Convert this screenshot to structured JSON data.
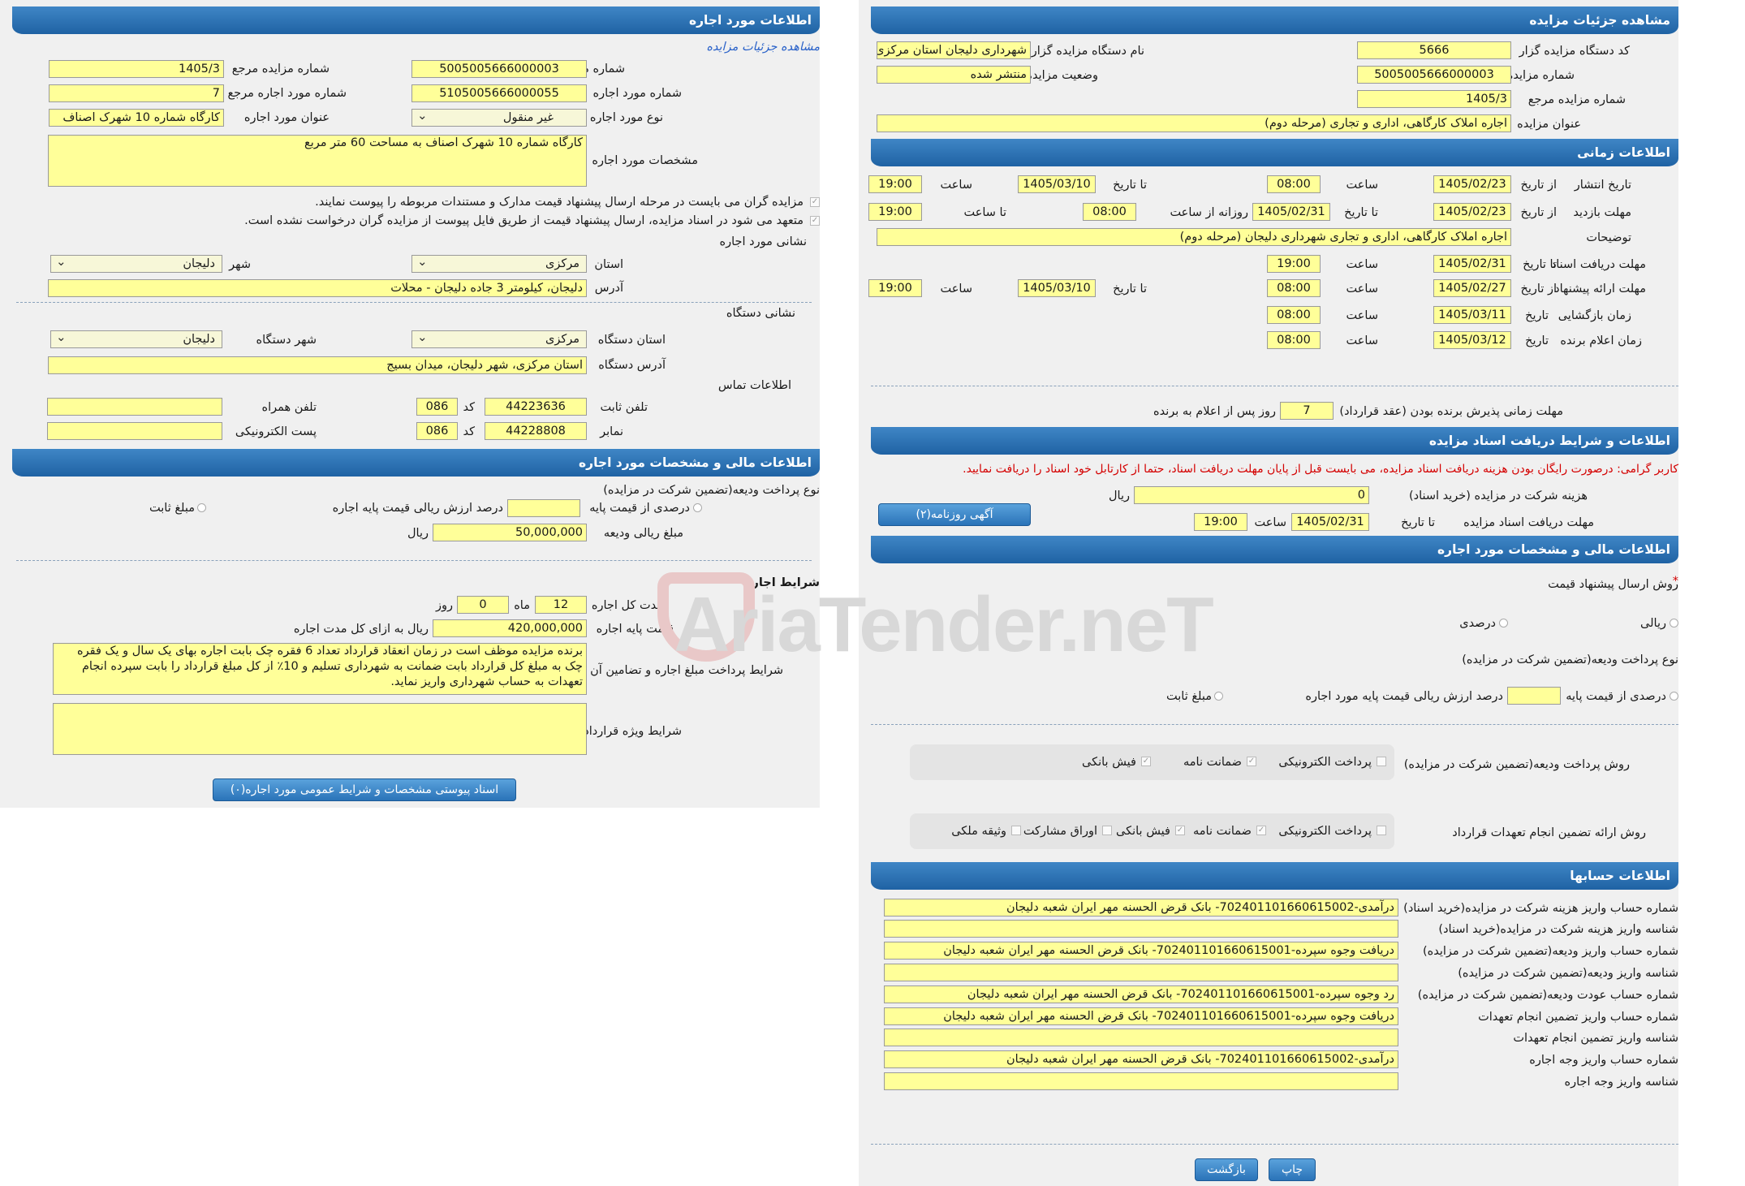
{
  "left": {
    "header": "اطلاعات مورد اجاره",
    "view_link": "مشاهده جزئیات مزایده",
    "fields": {
      "auction_no_label": "شماره مزایده",
      "auction_no": "5005005666000003",
      "ref_no_label": "شماره مزایده مرجع",
      "ref_no": "1405/3",
      "lease_item_no_label": "شماره مورد اجاره",
      "lease_item_no": "5105005666000055",
      "ref_lease_no_label": "شماره مورد اجاره مرجع",
      "ref_lease_no": "7",
      "lease_type_label": "نوع مورد اجاره",
      "lease_type": "غیر منقول",
      "lease_title_label": "عنوان مورد اجاره",
      "lease_title": "کارگاه شماره 10 شهرک اصناف",
      "specs_label": "مشخصات مورد اجاره",
      "specs": "کارگاه شماره 10 شهرک اصناف به مساحت 60 متر مربع"
    },
    "notes": [
      "مزایده گران می بایست در مرحله ارسال پیشنهاد قیمت مدارک و مستندات مربوطه را پیوست نمایند.",
      "متعهد می شود در اسناد مزایده، ارسال پیشنهاد قیمت از طریق فایل پیوست از مزایده گران درخواست نشده است."
    ],
    "address_title": "نشانی مورد اجاره",
    "province_label": "استان",
    "province": "مرکزی",
    "city_label": "شهر",
    "city": "دلیجان",
    "address_label": "آدرس",
    "address": "دلیجان، کیلومتر 3 جاده دلیجان - محلات",
    "device_title": "نشانی دستگاه",
    "device_province_label": "استان دستگاه",
    "device_province": "مرکزی",
    "device_city_label": "شهر دستگاه",
    "device_city": "دلیجان",
    "device_address_label": "آدرس دستگاه",
    "device_address": "استان مرکزی، شهر دلیجان، میدان بسیج",
    "contact_title": "اطلاعات تماس",
    "phone_label": "تلفن ثابت",
    "phone": "44223636",
    "code_label": "کد",
    "phone_code": "086",
    "mobile_label": "تلفن همراه",
    "mobile": "",
    "fax_label": "نمابر",
    "fax": "44228808",
    "fax_code": "086",
    "email_label": "پست الکترونیکی",
    "email": "",
    "fin_header": "اطلاعات مالی و مشخصات مورد اجاره",
    "deposit_type_label": "نوع پرداخت ودیعه(تضمین شرکت در مزایده)",
    "pct_label": "درصدی از قیمت پایه",
    "pct_of_base_label": "درصد ارزش ریالی قیمت پایه اجاره",
    "pct_value": "",
    "fixed_label": "مبلغ ثابت",
    "deposit_amount_label": "مبلغ ریالی ودیعه",
    "deposit_amount": "50,000,000",
    "rial": "ریال",
    "terms_title": "شرایط اجاره",
    "duration_label": "مدت کل اجاره",
    "duration_months": "12",
    "month_label": "ماه",
    "duration_days": "0",
    "day_label": "روز",
    "base_price_label": "قیمت پایه اجاره",
    "base_price": "420,000,000",
    "base_price_unit": "ریال به ازای کل مدت اجاره",
    "payment_terms_label": "شرایط پرداخت مبلغ اجاره و تضامین آن",
    "payment_terms": "برنده مزایده موظف است در زمان انعقاد قرارداد تعداد 6 فقره چک بابت اجاره بهای یک سال و یک فقره چک به مبلغ کل قرارداد بابت ضمانت به شهرداری تسلیم و 10٪ از کل مبلغ قرارداد را بابت سپرده انجام تعهدات به حساب شهرداری واریز نماید.",
    "special_terms_label": "شرایط ویژه قرارداد",
    "special_terms": "",
    "attachments_button": "اسناد پیوستی مشخصات و شرایط عمومی مورد اجاره(۰)"
  },
  "right": {
    "header": "مشاهده جزئیات مزایده",
    "org_code_label": "کد دستگاه مزایده گزار",
    "org_code": "5666",
    "org_name_label": "نام دستگاه مزایده گزار",
    "org_name": "شهرداری دلیجان استان مرکزی",
    "auction_no_label": "شماره مزایده",
    "auction_no": "5005005666000003",
    "status_label": "وضعیت مزایده",
    "status": "منتشر شده",
    "ref_no_label": "شماره مزایده مرجع",
    "ref_no": "1405/3",
    "title_label": "عنوان مزایده",
    "title": "اجاره املاک کارگاهی، اداری و تجاری (مرحله دوم)",
    "time_header": "اطلاعات زمانی",
    "publish_label": "تاریخ انتشار",
    "from_date": "از تاریخ",
    "to_date": "تا تاریخ",
    "time": "ساعت",
    "publish_from": "1405/02/23",
    "publish_from_time": "08:00",
    "publish_to": "1405/03/10",
    "publish_to_time": "19:00",
    "visit_label": "مهلت بازدید",
    "visit_from": "1405/02/23",
    "visit_to": "1405/02/31",
    "daily_from_label": "روزانه از ساعت",
    "daily_from": "08:00",
    "to_time_label": "تا ساعت",
    "daily_to": "19:00",
    "desc_label": "توضیحات",
    "desc": "اجاره املاک کارگاهی، اداری و تجاری شهرداری دلیجان (مرحله دوم)",
    "doc_deadline_label": "مهلت دریافت اسناد",
    "doc_to": "1405/02/31",
    "doc_to_time": "19:00",
    "offer_label": "مهلت ارائه پیشنهاد",
    "offer_from": "1405/02/27",
    "offer_from_time": "08:00",
    "offer_to": "1405/03/10",
    "offer_to_time": "19:00",
    "opening_label": "زمان بازگشایی",
    "date_label": "تاریخ",
    "opening_date": "1405/03/11",
    "opening_time": "08:00",
    "winner_label": "زمان اعلام برنده",
    "winner_date": "1405/03/12",
    "winner_time": "08:00",
    "acceptance_label": "مهلت زمانی پذیرش برنده بودن (عقد قرارداد)",
    "acceptance_days": "7",
    "acceptance_suffix": "روز پس از اعلام به برنده",
    "docs_header": "اطلاعات و شرایط دریافت اسناد مزایده",
    "warning": "کاربر گرامی: درصورت رایگان بودن هزینه دریافت اسناد مزایده، می بایست قبل از پایان مهلت دریافت اسناد، حتما از کارتابل خود اسناد را دریافت نمایید.",
    "fee_label": "هزینه شرکت در مزایده (خرید اسناد)",
    "fee": "0",
    "rial": "ریال",
    "doc_receive_label": "مهلت دریافت اسناد مزایده",
    "doc_receive_to": "1405/02/31",
    "doc_receive_time": "19:00",
    "newspaper_button": "آگهی روزنامه(۲)",
    "fin_header": "اطلاعات مالی و مشخصات مورد اجاره",
    "price_method_label": "روش ارسال پیشنهاد قیمت",
    "rial_opt": "ریالی",
    "pct_opt": "درصدی",
    "deposit_type_label": "نوع پرداخت ودیعه(تضمین شرکت در مزایده)",
    "pct_base_opt": "درصدی از قیمت پایه",
    "pct_base_suffix": "درصد ارزش ریالی قیمت پایه مورد اجاره",
    "pct_base_value": "",
    "fixed_opt": "مبلغ ثابت",
    "deposit_method_label": "روش پرداخت ودیعه(تضمین شرکت در مزایده)",
    "deposit_methods": [
      "پرداخت الکترونیکی",
      "ضمانت نامه",
      "فیش بانکی"
    ],
    "commit_method_label": "روش ارائه تضمین انجام تعهدات قرارداد",
    "commit_methods": [
      "پرداخت الکترونیکی",
      "ضمانت نامه",
      "فیش بانکی",
      "اوراق مشارکت",
      "وثیقه ملکی"
    ],
    "accounts_header": "اطلاعات حسابها",
    "accounts": [
      {
        "label": "شماره حساب واریز هزینه شرکت در مزایده(خرید اسناد)",
        "value": "درآمدی-70240110166061​5002- بانک قرض الحسنه مهر ایران شعبه دلیجان"
      },
      {
        "label": "شناسه واریز هزینه شرکت در مزایده(خرید اسناد)",
        "value": ""
      },
      {
        "label": "شماره حساب واریز ودیعه(تضمین شرکت در مزایده)",
        "value": "دریافت وجوه سپرده-702401101660615001- بانک قرض الحسنه مهر ایران شعبه دلیجان"
      },
      {
        "label": "شناسه واریز ودیعه(تضمین شرکت در مزایده)",
        "value": ""
      },
      {
        "label": "شماره حساب عودت ودیعه(تضمین شرکت در مزایده)",
        "value": "رد وجوه سپرده-702401101660615001- بانک قرض الحسنه مهر ایران شعبه دلیجان"
      },
      {
        "label": "شماره حساب واریز تضمین انجام تعهدات",
        "value": "دریافت وجوه سپرده-702401101660615001- بانک قرض الحسنه مهر ایران شعبه دلیجان"
      },
      {
        "label": "شناسه واریز تضمین انجام تعهدات",
        "value": ""
      },
      {
        "label": "شماره حساب واریز وجه اجاره",
        "value": "درآمدی-702401101660615002- بانک قرض الحسنه مهر ایران شعبه دلیجان"
      },
      {
        "label": "شناسه واریز وجه اجاره",
        "value": ""
      }
    ],
    "print_button": "چاپ",
    "back_button": "بازگشت"
  },
  "watermark": "AriaTender.neT"
}
